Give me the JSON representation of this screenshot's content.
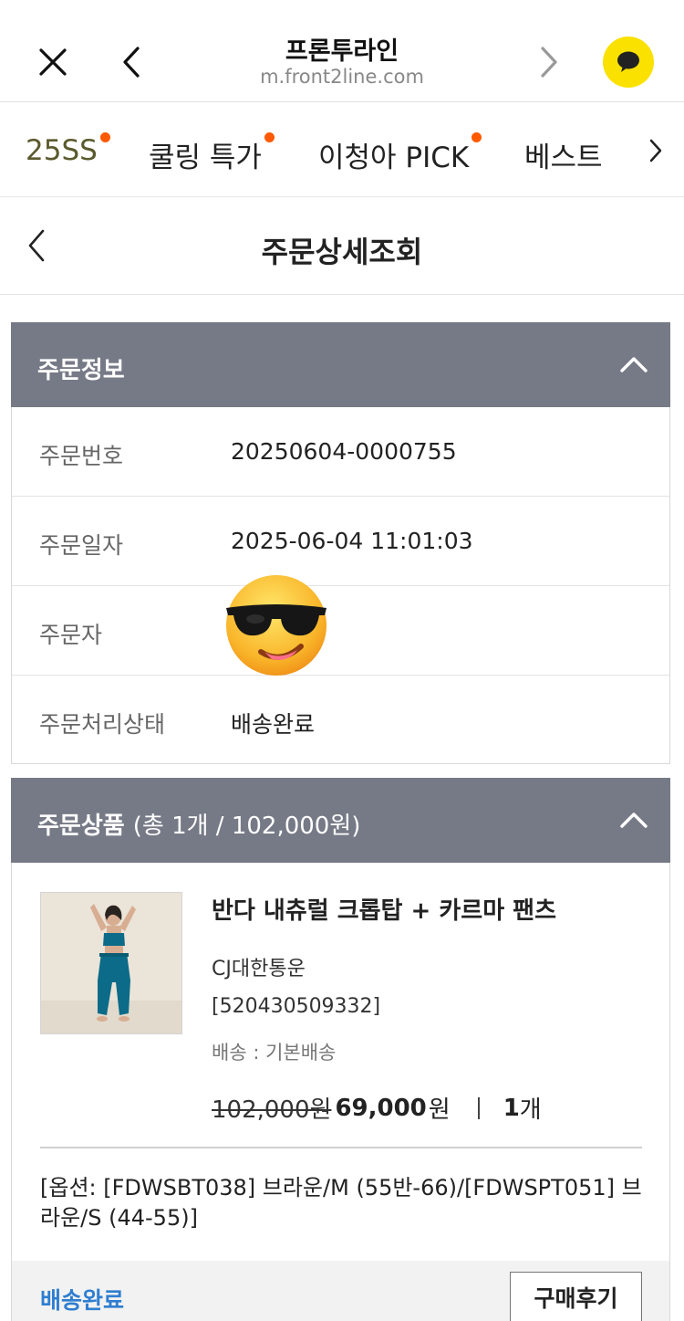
{
  "browser": {
    "title": "프론투라인",
    "url": "m.front2line.com"
  },
  "categories": [
    {
      "label": "25SS",
      "badge": true
    },
    {
      "label": "쿨링 특가",
      "badge": true
    },
    {
      "label": "이청아 PICK",
      "badge": true
    },
    {
      "label": "베스트",
      "badge": false
    }
  ],
  "page": {
    "title": "주문상세조회"
  },
  "order_info": {
    "heading": "주문정보",
    "rows": [
      {
        "label": "주문번호",
        "value": "20250604-0000755"
      },
      {
        "label": "주문일자",
        "value": "2025-06-04 11:01:03"
      },
      {
        "label": "주문자",
        "value": ""
      },
      {
        "label": "주문처리상태",
        "value": "배송완료"
      }
    ]
  },
  "order_items": {
    "heading": "주문상품",
    "summary": "(총 1개 / 102,000원)",
    "product": {
      "name": "반다 내츄럴 크롭탑 + 카르마 팬츠",
      "carrier": "CJ대한통운",
      "tracking": "[520430509332]",
      "shipping": "배송 : 기본배송",
      "price_original": "102,000원",
      "price_sale": "69,000",
      "price_unit": "원",
      "quantity": "1",
      "quantity_unit": "개",
      "option": "[옵션: [FDWSBT038] 브라운/M (55반-66)/[FDWSPT051] 브라운/S (44-55)]",
      "status": "배송완료",
      "review_button": "구매후기"
    }
  },
  "colors": {
    "section_header_bg": "#767a86",
    "kakao_yellow": "#fae100",
    "badge_dot": "#ff5a00",
    "status_blue": "#2f7ed0",
    "active_tab": "#5a5a2e"
  },
  "icons": {
    "close": "close-icon",
    "back": "chevron-left-icon",
    "forward": "chevron-right-icon",
    "kakao": "speech-bubble-icon",
    "collapse": "chevron-up-icon"
  }
}
